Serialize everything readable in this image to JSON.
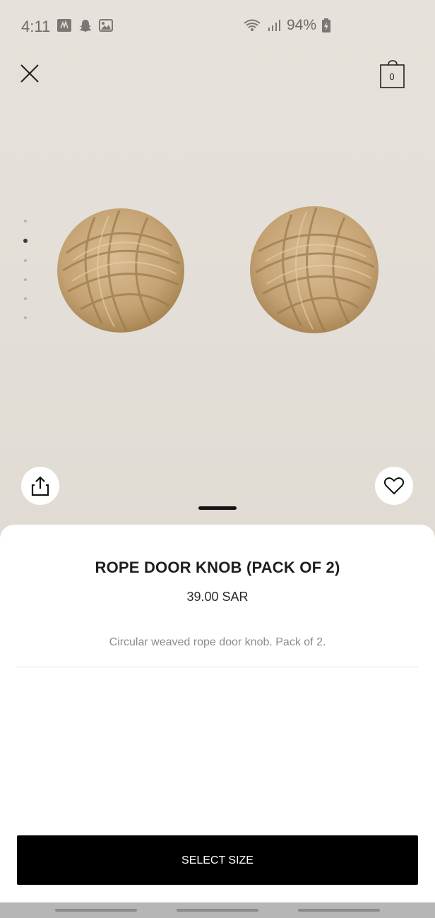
{
  "status_bar": {
    "time": "4:11",
    "battery": "94%",
    "icons": [
      "notification-icon",
      "snapchat-icon",
      "gallery-icon",
      "wifi-icon",
      "signal-icon",
      "battery-charging-icon"
    ]
  },
  "header": {
    "close_icon": "close-icon",
    "bag_icon": "shopping-bag-icon",
    "bag_count": "0"
  },
  "gallery": {
    "image_count": 6,
    "active_index": 1,
    "image_subject": "two rope door knobs"
  },
  "actions": {
    "share_icon": "share-icon",
    "favorite_icon": "heart-icon"
  },
  "product": {
    "title": "ROPE DOOR KNOB (PACK OF 2)",
    "price": "39.00 SAR",
    "description": "Circular weaved rope door knob. Pack of 2."
  },
  "cta": {
    "select_size_label": "SELECT SIZE"
  },
  "colors": {
    "background": "#e5e1da",
    "rope": "#c8a87a",
    "button": "#000000",
    "sheet": "#ffffff"
  }
}
